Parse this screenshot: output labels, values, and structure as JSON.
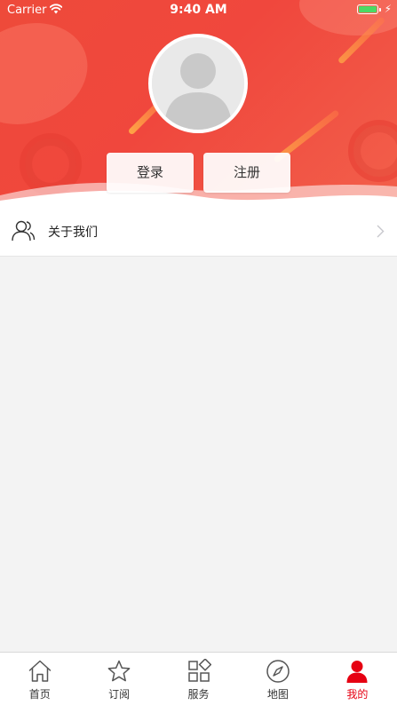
{
  "status_bar": {
    "carrier": "Carrier",
    "time": "9:40 AM",
    "battery_color": "#4cd964"
  },
  "theme": {
    "accent": "#e60012",
    "header_red": "#ef4a3c"
  },
  "profile": {
    "login_label": "登录",
    "register_label": "注册"
  },
  "menu": {
    "items": [
      {
        "label": "关于我们",
        "icon": "person-group-icon"
      }
    ]
  },
  "tabbar": {
    "active_index": 4,
    "tabs": [
      {
        "label": "首页",
        "icon": "home-icon"
      },
      {
        "label": "订阅",
        "icon": "star-icon"
      },
      {
        "label": "服务",
        "icon": "grid-icon"
      },
      {
        "label": "地图",
        "icon": "compass-icon"
      },
      {
        "label": "我的",
        "icon": "user-icon"
      }
    ]
  }
}
